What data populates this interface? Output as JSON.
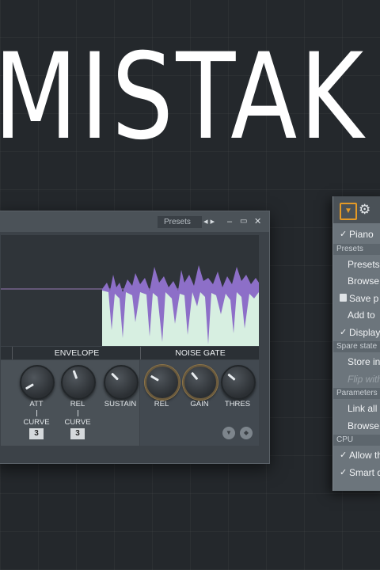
{
  "headline": "MISTAK",
  "plugin": {
    "presets_label": "Presets",
    "nav_arrows": "◂ ▸",
    "minimize": "–",
    "maximize": "▭",
    "close": "✕",
    "sections": [
      "ENVELOPE",
      "NOISE GATE"
    ],
    "knobs": [
      {
        "label": "ATT"
      },
      {
        "label": "REL"
      },
      {
        "label": "SUSTAIN"
      },
      {
        "label": "REL"
      },
      {
        "label": "GAIN"
      },
      {
        "label": "THRES"
      }
    ],
    "curve_label": "CURVE",
    "curve_values": [
      "3",
      "3"
    ]
  },
  "menu": {
    "items": [
      {
        "type": "item",
        "label": "Piano",
        "checked": true
      },
      {
        "type": "header",
        "label": "Presets"
      },
      {
        "type": "item",
        "label": "Presets"
      },
      {
        "type": "item",
        "label": "Browse"
      },
      {
        "type": "item",
        "label": "Save p",
        "icon": "save-icon"
      },
      {
        "type": "item",
        "label": "Add to"
      },
      {
        "type": "item",
        "label": "Display",
        "checked": true
      },
      {
        "type": "header",
        "label": "Spare state"
      },
      {
        "type": "item",
        "label": "Store in"
      },
      {
        "type": "item",
        "label": "Flip with",
        "dim": true
      },
      {
        "type": "header",
        "label": "Parameters"
      },
      {
        "type": "item",
        "label": "Link all p"
      },
      {
        "type": "item",
        "label": "Browse p"
      },
      {
        "type": "header",
        "label": "CPU"
      },
      {
        "type": "item",
        "label": "Allow thre",
        "checked": true
      },
      {
        "type": "item",
        "label": "Smart dis",
        "checked": true
      }
    ]
  },
  "colors": {
    "accent": "#e59a26",
    "waveform": "#d7efe1",
    "waveform_peaks": "#8d6fc8"
  }
}
